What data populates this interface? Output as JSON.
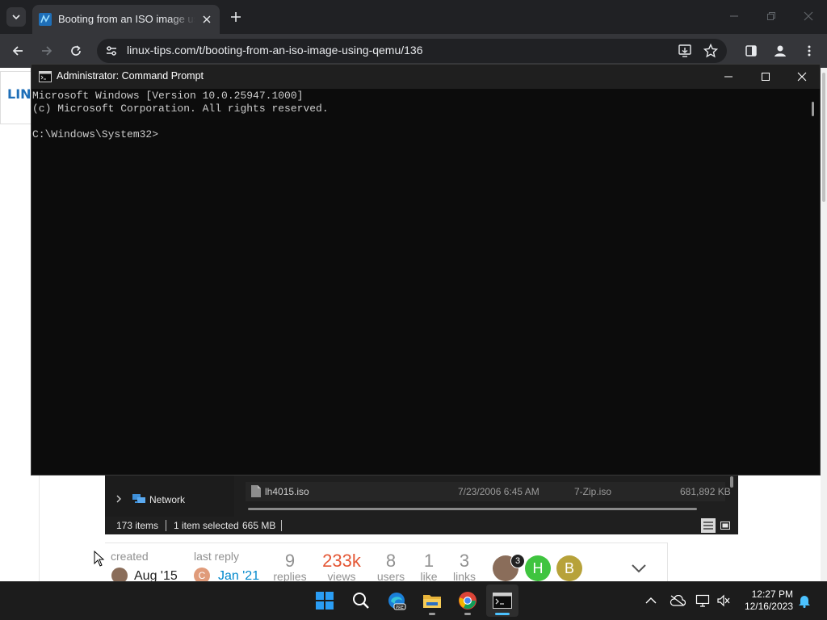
{
  "browser": {
    "tab_title": "Booting from an ISO image using QEMU",
    "url_host": "linux-tips.com",
    "url_path": "/t/booting-from-an-iso-image-using-qemu/136"
  },
  "site": {
    "logo_text": "LIN"
  },
  "cmd": {
    "title": "Administrator: Command Prompt",
    "line1": "Microsoft Windows [Version 10.0.25947.1000]",
    "line2": "(c) Microsoft Corporation. All rights reserved.",
    "prompt": "C:\\Windows\\System32>"
  },
  "explorer": {
    "nav_item": "Network",
    "file": {
      "name": "lh4015.iso",
      "date": "7/23/2006 6:45 AM",
      "type": "7-Zip.iso",
      "size": "681,892 KB"
    },
    "status": {
      "items": "173 items",
      "selected": "1 item selected",
      "size": "665 MB"
    }
  },
  "topic_meta": {
    "created_label": "created",
    "created_date": "Aug '15",
    "last_reply_label": "last reply",
    "last_reply_date": "Jan '21",
    "last_reply_initial": "C",
    "stats": [
      {
        "value": "9",
        "label": "replies"
      },
      {
        "value": "233k",
        "label": "views"
      },
      {
        "value": "8",
        "label": "users"
      },
      {
        "value": "1",
        "label": "like"
      },
      {
        "value": "3",
        "label": "links"
      }
    ],
    "participants": [
      {
        "initial": "",
        "badge": "3",
        "color": "#8a6d5a"
      },
      {
        "initial": "H",
        "color": "#3fc43f"
      },
      {
        "initial": "B",
        "color": "#b7a23a"
      }
    ],
    "colors": {
      "views": "#e45735",
      "date_link": "#0088cc",
      "text": "#222222"
    }
  },
  "taskbar": {
    "time": "12:27 PM",
    "date": "12/16/2023"
  }
}
